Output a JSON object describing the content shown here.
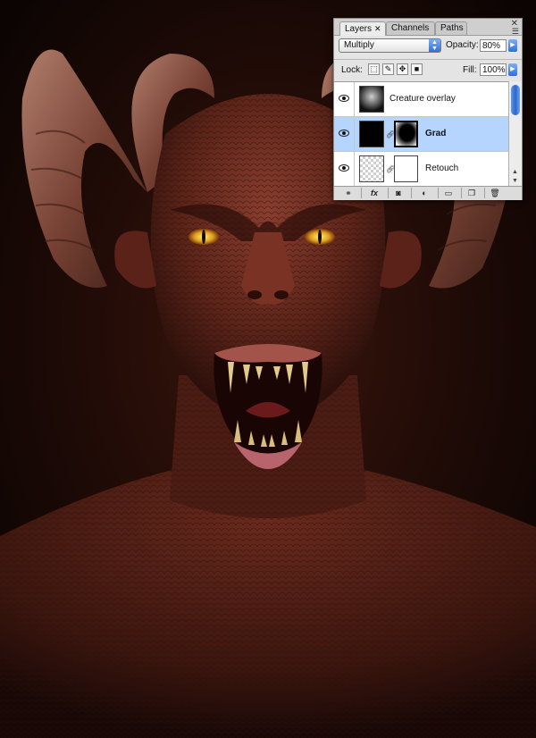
{
  "layers_panel": {
    "tabs": [
      {
        "label": "Layers",
        "close": "✕"
      },
      {
        "label": "Channels"
      },
      {
        "label": "Paths"
      }
    ],
    "panel_close": "✕",
    "menu_icon": "☰",
    "blend_mode": "Multiply",
    "opacity_label": "Opacity:",
    "opacity_value": "80%",
    "lock_label": "Lock:",
    "fill_label": "Fill:",
    "fill_value": "100%",
    "layers": [
      {
        "name": "Creature overlay",
        "selected": false,
        "visible": true
      },
      {
        "name": "Grad",
        "selected": true,
        "visible": true
      },
      {
        "name": "Retouch",
        "selected": false,
        "visible": true
      }
    ],
    "bottom_icons": [
      "link-layers-icon",
      "fx-icon",
      "add-mask-icon",
      "adjustment-layer-icon",
      "new-group-icon",
      "new-layer-icon",
      "trash-icon"
    ],
    "fx_label": "fx"
  },
  "colors": {
    "selected_row": "#b5d5ff",
    "accent_blue": "#2f6fd8"
  }
}
